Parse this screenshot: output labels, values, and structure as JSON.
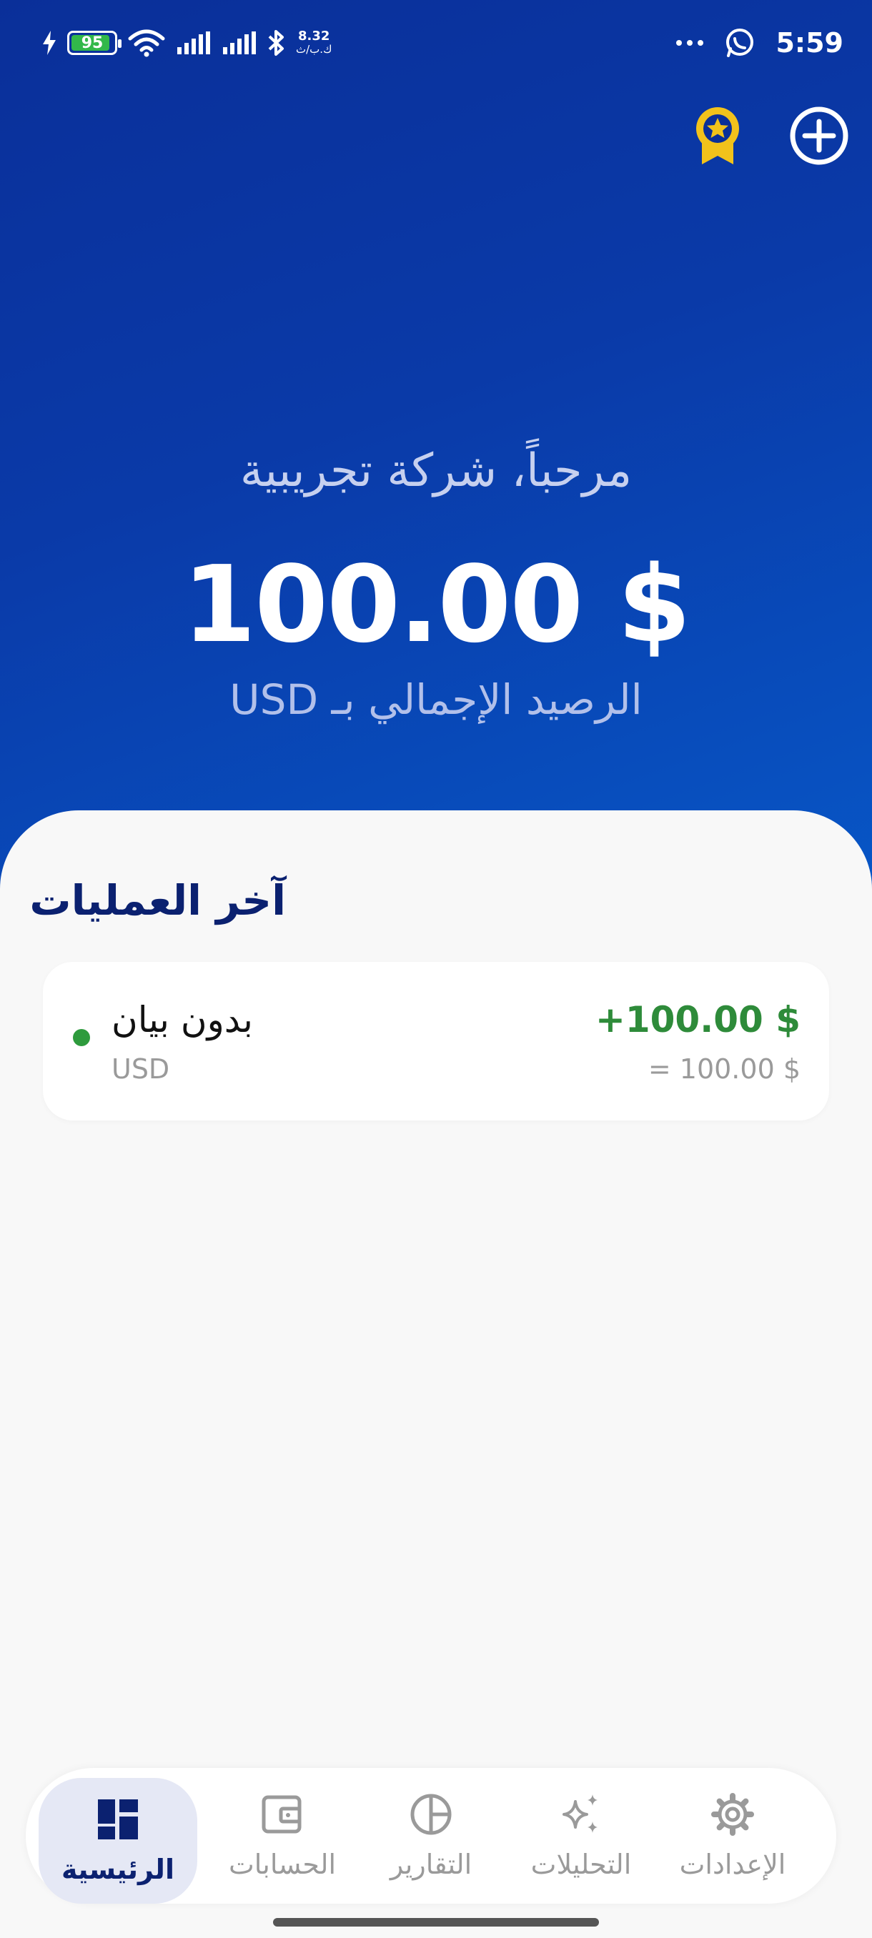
{
  "status_bar": {
    "battery": "95",
    "net_speed_value": "8.32",
    "net_speed_unit": "ك.ب/ث",
    "time": "5:59"
  },
  "header": {
    "greeting": "مرحباً، شركة تجريبية",
    "balance": "100.00 $",
    "balance_label": "الرصيد الإجمالي بـ USD"
  },
  "recent": {
    "title": "آخر العمليات",
    "transactions": [
      {
        "name": "بدون بيان",
        "currency": "USD",
        "amount": "+100.00 $",
        "equivalent": "= 100.00 $"
      }
    ]
  },
  "nav": {
    "items": [
      {
        "label": "الرئيسية",
        "icon": "dashboard-icon",
        "active": true
      },
      {
        "label": "الحسابات",
        "icon": "wallet-icon",
        "active": false
      },
      {
        "label": "التقارير",
        "icon": "pie-chart-icon",
        "active": false
      },
      {
        "label": "التحليلات",
        "icon": "sparkles-icon",
        "active": false
      },
      {
        "label": "الإعدادات",
        "icon": "gear-icon",
        "active": false
      }
    ]
  },
  "colors": {
    "hero_top": "#0a2f99",
    "hero_bottom": "#0756c6",
    "accent_navy": "#0b2170",
    "positive": "#2e8b3a",
    "award_gold": "#f2c21b"
  }
}
